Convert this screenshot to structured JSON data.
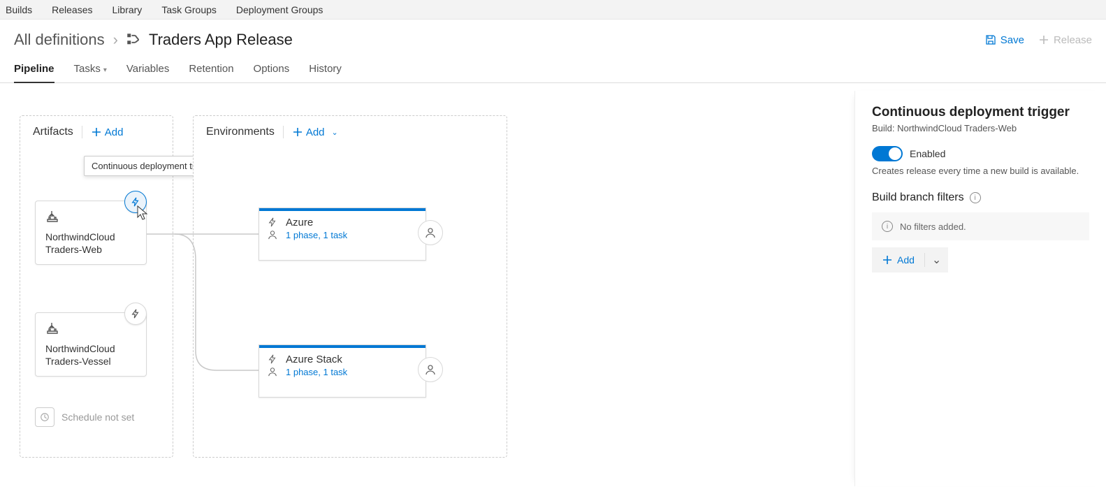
{
  "topnav": [
    "Builds",
    "Releases",
    "Library",
    "Task Groups",
    "Deployment Groups"
  ],
  "breadcrumb": {
    "root": "All definitions",
    "title": "Traders App Release"
  },
  "actions": {
    "save": "Save",
    "release": "Release"
  },
  "tabs": [
    {
      "label": "Pipeline",
      "active": true
    },
    {
      "label": "Tasks",
      "chevron": true
    },
    {
      "label": "Variables"
    },
    {
      "label": "Retention"
    },
    {
      "label": "Options"
    },
    {
      "label": "History"
    }
  ],
  "artifacts_panel": {
    "title": "Artifacts",
    "add": "Add"
  },
  "env_panel": {
    "title": "Environments",
    "add": "Add"
  },
  "artifacts": [
    {
      "name": "NorthwindCloud Traders-Web"
    },
    {
      "name": "NorthwindCloud Traders-Vessel"
    }
  ],
  "tooltip": "Continuous deployment trigger",
  "schedule": "Schedule not set",
  "environments": [
    {
      "name": "Azure",
      "sub": "1 phase, 1 task"
    },
    {
      "name": "Azure Stack",
      "sub": "1 phase, 1 task"
    }
  ],
  "side": {
    "title": "Continuous deployment trigger",
    "sub": "Build: NorthwindCloud Traders-Web",
    "toggle": "Enabled",
    "desc": "Creates release every time a new build is available.",
    "filters_title": "Build branch filters",
    "empty": "No filters added.",
    "add": "Add"
  }
}
